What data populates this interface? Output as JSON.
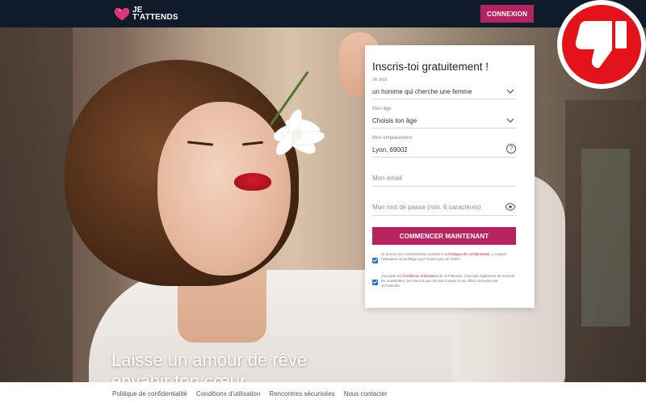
{
  "header": {
    "logo_line1": "JE",
    "logo_line2": "T'ATTENDS",
    "login_label": "CONNEXION"
  },
  "hero": {
    "headline_line1": "Laisse un amour de rêve",
    "headline_line2": "envahir ton cœur"
  },
  "form": {
    "title": "Inscris-toi gratuitement !",
    "iam": {
      "label": "Je suis",
      "value": "un homme qui cherche une femme"
    },
    "age": {
      "label": "Mon âge",
      "value": "Choisis ton âge"
    },
    "location": {
      "label": "Mon emplacement",
      "value": "Lyon, 69002",
      "help_icon": "?"
    },
    "email": {
      "placeholder": "Mon email"
    },
    "password": {
      "placeholder": "Mon mot de passe (min. 6 caractères)"
    },
    "submit_label": "COMMENCER MAINTENANT",
    "consent1": {
      "before": "Je donne mon consentement explicite à la",
      "link": "Politique de confidentialité",
      "after": ", y compris l'utilisation du profilage pour trouver plus de match",
      "checked": true
    },
    "consent2": {
      "before": "J'accepte les",
      "link": "Conditions d'utilisation",
      "after": "de JeT'attends. J'accepte également de recevoir les newsletters, les mises à jour de mon compte et les offres envoyées par JeT'attends.",
      "checked": true
    }
  },
  "footer": {
    "links": [
      "Politique de confidentialité",
      "Conditions d'utilisation",
      "Rencontres sécurisées",
      "Nous contacter"
    ]
  },
  "colors": {
    "brand": "#b5245f",
    "topbar": "#0f1b2b",
    "badge": "#e3121b"
  },
  "icons": {
    "badge": "thumbs-down-icon",
    "logo": "heart-logo-icon"
  }
}
